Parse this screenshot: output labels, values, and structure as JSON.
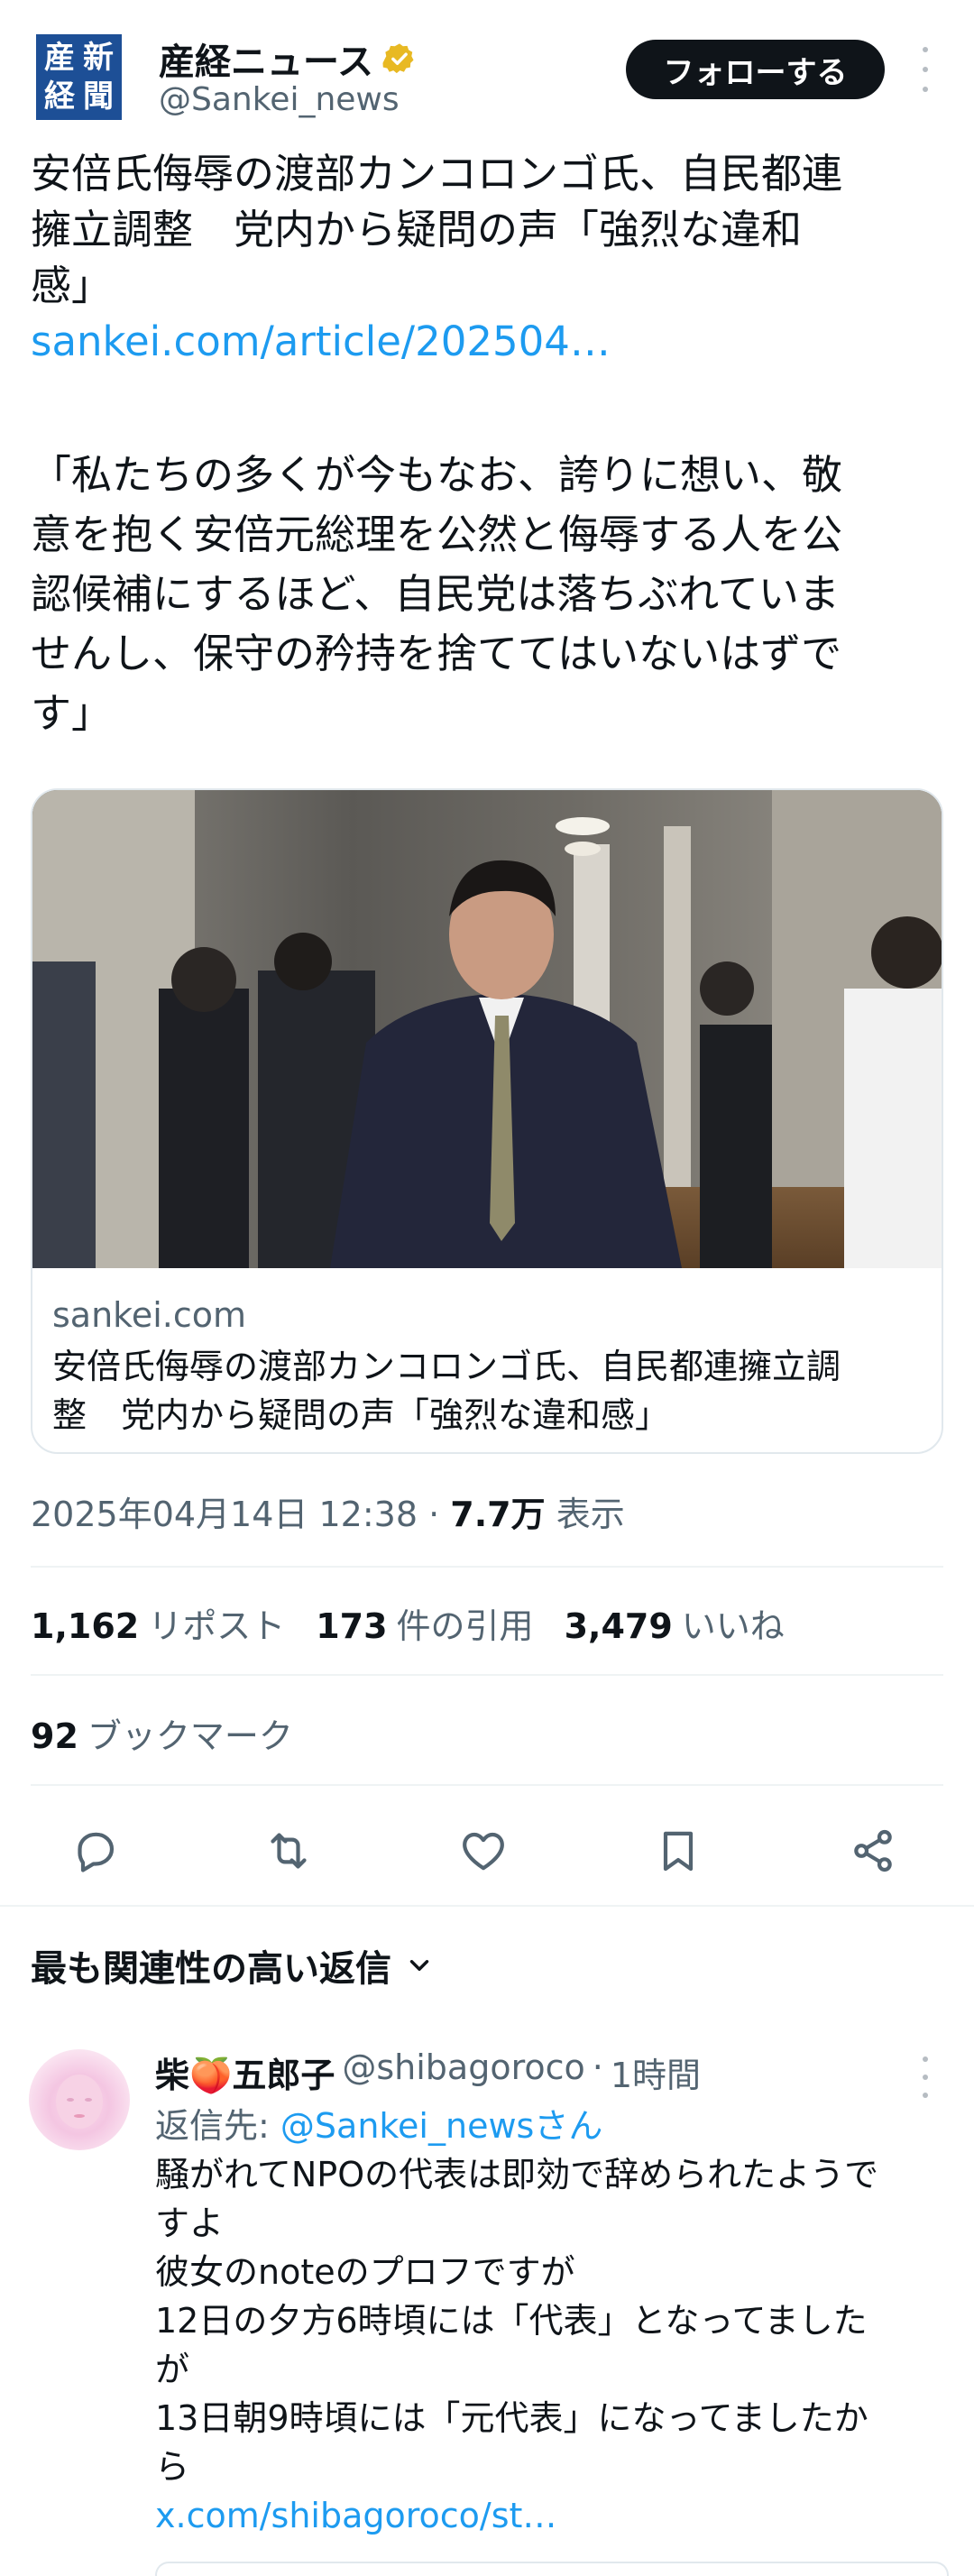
{
  "account": {
    "logo_chars": [
      "新",
      "産",
      "聞",
      "経"
    ],
    "name": "産経ニュース",
    "handle": "@Sankei_news",
    "follow_label": "フォローする",
    "verified_color": "#e8b923"
  },
  "tweet": {
    "headline_lines": [
      "安倍氏侮辱の渡部カンコロンゴ氏、自民都連",
      "擁立調整　党内から疑問の声「強烈な違和",
      "感」"
    ],
    "link": "sankei.com/article/202504…",
    "quote_lines": [
      "「私たちの多くが今もなお、誇りに想い、敬",
      "意を抱く安倍元総理を公然と侮辱する人を公",
      "認候補にするほど、自民党は落ちぶれていま",
      "せんし、保守の矜持を捨ててはいないはずで",
      "す」"
    ]
  },
  "card": {
    "image_desc": "photo",
    "domain": "sankei.com",
    "title_lines": [
      "安倍氏侮辱の渡部カンコロンゴ氏、自民都連擁立調",
      "整　党内から疑問の声「強烈な違和感」"
    ]
  },
  "meta": {
    "timestamp": "2025年04月14日 12:38",
    "separator": "·",
    "views": "7.7万",
    "views_label": "表示"
  },
  "stats": {
    "reposts": "1,162",
    "reposts_label": "リポスト",
    "quotes": "173",
    "quotes_label": "件の引用",
    "likes": "3,479",
    "likes_label": "いいね",
    "bookmarks": "92",
    "bookmarks_label": "ブックマーク"
  },
  "sort": {
    "label": "最も関連性の高い返信"
  },
  "reply": {
    "name_prefix": "柴",
    "name_emoji": "🍑",
    "name_suffix": "五郎子",
    "handle": "@shibagoroco",
    "separator": "·",
    "time": "1時間",
    "reply_to_label": "返信先:",
    "reply_to_mention": "@Sankei_newsさん",
    "body_lines": [
      "騒がれてNPOの代表は即効で辞められたようで",
      "すよ",
      "彼女のnoteのプロフですが",
      "12日の夕方6時頃には「代表」となってました",
      "が",
      "13日朝9時頃には「元代表」になってましたか",
      "ら"
    ],
    "link": "x.com/shibagoroco/st…"
  }
}
